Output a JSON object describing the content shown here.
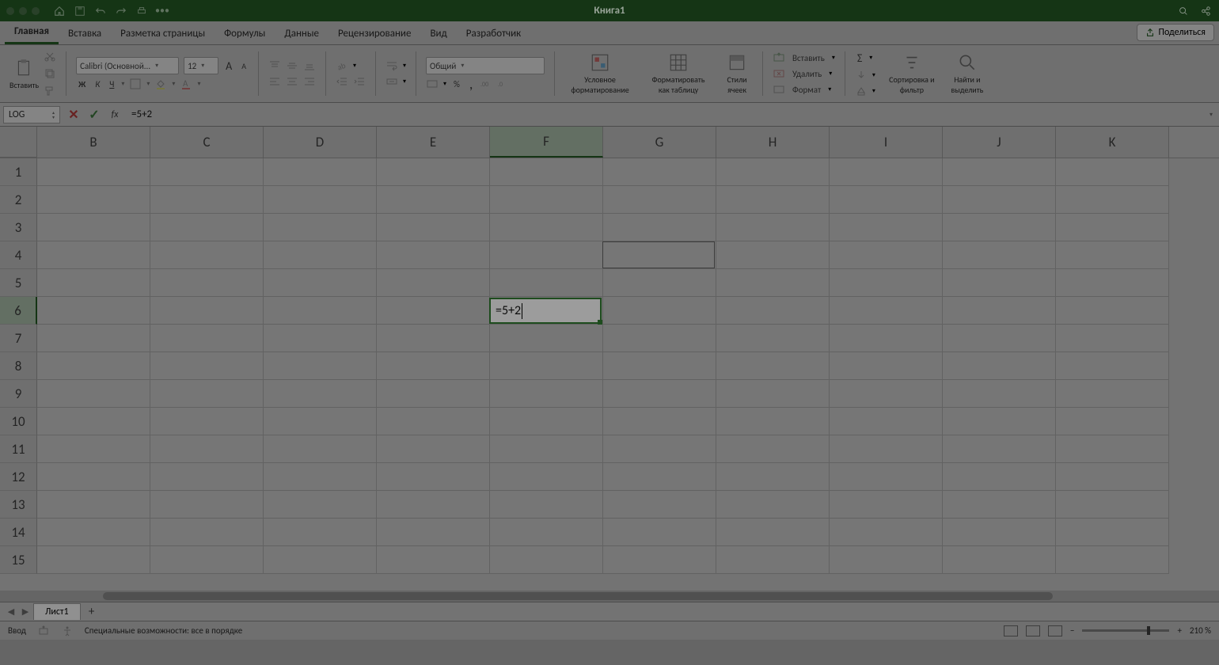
{
  "title": "Книга1",
  "tabs": [
    "Главная",
    "Вставка",
    "Разметка страницы",
    "Формулы",
    "Данные",
    "Рецензирование",
    "Вид",
    "Разработчик"
  ],
  "active_tab": 0,
  "share": "Поделиться",
  "ribbon": {
    "paste": "Вставить",
    "font_name": "Calibri (Основной...",
    "font_size": "12",
    "number_format": "Общий",
    "cond_fmt": "Условное форматирование",
    "fmt_table": "Форматировать как таблицу",
    "cell_styles": "Стили ячеек",
    "insert": "Вставить",
    "delete": "Удалить",
    "format": "Формат",
    "sort": "Сортировка и фильтр",
    "find": "Найти и выделить"
  },
  "formula_bar": {
    "name_box": "LOG",
    "formula": "=5+2"
  },
  "grid": {
    "columns": [
      "B",
      "C",
      "D",
      "E",
      "F",
      "G",
      "H",
      "I",
      "J",
      "K"
    ],
    "row_count": 15,
    "active_col": "F",
    "active_row": 6,
    "prev_sel": {
      "col": "G",
      "row": 4
    },
    "editing_value": "=5+2"
  },
  "sheet_tab": "Лист1",
  "status": {
    "mode": "Ввод",
    "a11y": "Специальные возможности: все в порядке",
    "zoom": "210 %"
  }
}
